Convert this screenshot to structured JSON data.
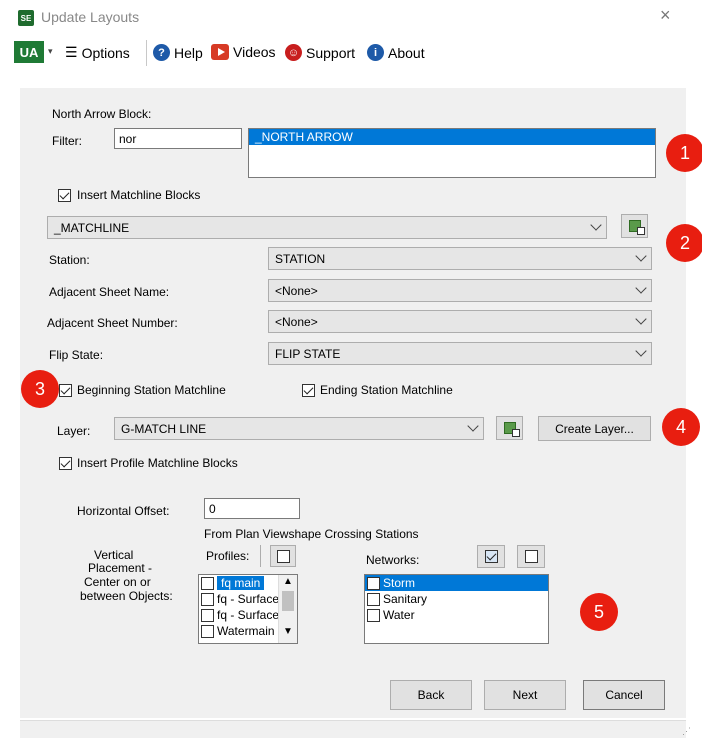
{
  "window": {
    "app_icon_text": "SE",
    "title": "Update Layouts",
    "close_glyph": "×"
  },
  "toolbar": {
    "logo_text": "UA",
    "options_label": "Options",
    "help_label": "Help",
    "videos_label": "Videos",
    "support_label": "Support",
    "about_label": "About"
  },
  "north_arrow": {
    "section_label": "North Arrow Block:",
    "filter_label": "Filter:",
    "filter_value": "nor",
    "list_items": [
      "_NORTH ARROW"
    ]
  },
  "matchline": {
    "insert_label": "Insert Matchline Blocks",
    "insert_checked": true,
    "block_value": "_MATCHLINE",
    "station_label": "Station:",
    "station_value": "STATION",
    "adj_name_label": "Adjacent Sheet Name:",
    "adj_name_value": "<None>",
    "adj_number_label": "Adjacent Sheet Number:",
    "adj_number_value": "<None>",
    "flip_label": "Flip State:",
    "flip_value": "FLIP STATE",
    "beginning_label": "Beginning Station Matchline",
    "beginning_checked": true,
    "ending_label": "Ending Station Matchline",
    "ending_checked": true,
    "layer_label": "Layer:",
    "layer_value": "G-MATCH LINE",
    "create_layer_label": "Create Layer..."
  },
  "profile": {
    "insert_label": "Insert Profile Matchline Blocks",
    "insert_checked": true,
    "h_offset_label": "Horizontal Offset:",
    "h_offset_value": "0",
    "crossing_label": "From Plan Viewshape Crossing Stations",
    "vertical_label_1": "Vertical",
    "vertical_label_2": "Placement -",
    "vertical_label_3": "Center on or",
    "vertical_label_4": "between Objects:",
    "profiles_label": "Profiles:",
    "profiles_items": [
      "fq main",
      "fq - Surface",
      "fq - Surface",
      "Watermain"
    ],
    "networks_label": "Networks:",
    "networks_items": [
      "Storm",
      "Sanitary",
      "Water"
    ]
  },
  "buttons": {
    "back": "Back",
    "next": "Next",
    "cancel": "Cancel"
  },
  "badges": [
    "1",
    "2",
    "3",
    "4",
    "5"
  ],
  "colors": {
    "badge": "#e81e10",
    "selection": "#0078d7",
    "panel": "#f0f0f0"
  }
}
